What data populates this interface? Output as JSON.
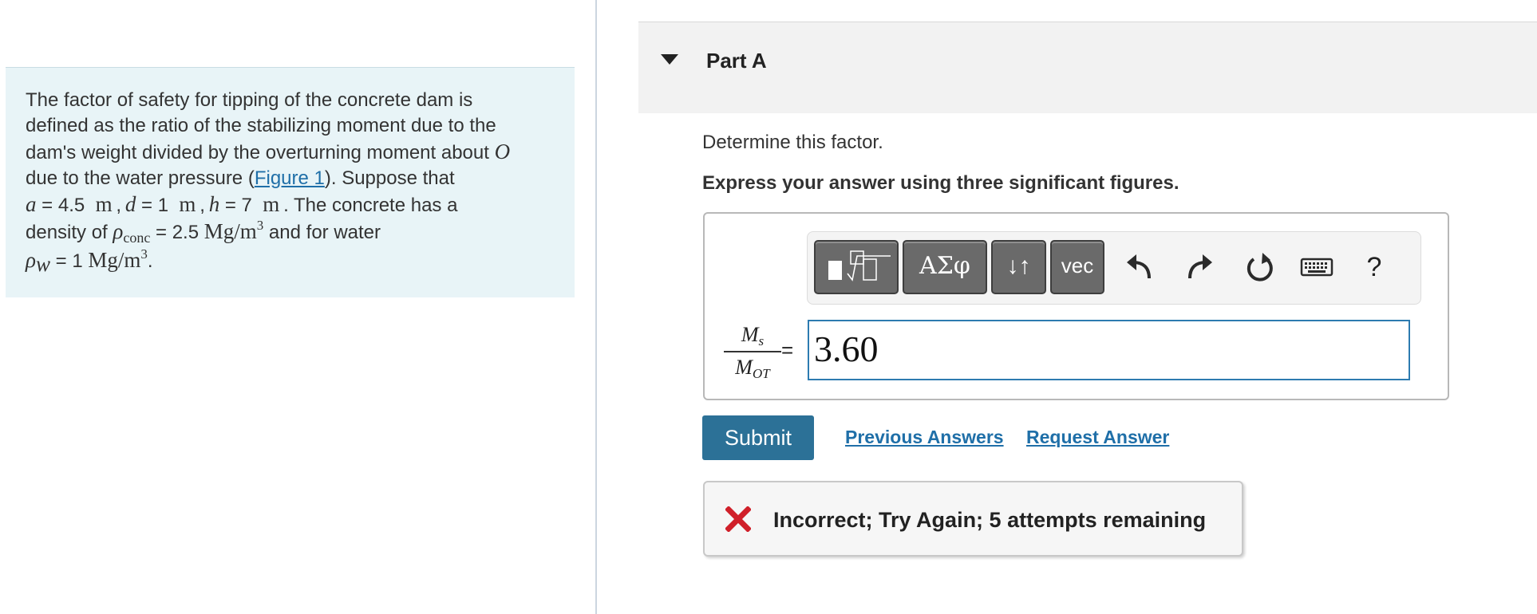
{
  "problem": {
    "line1": "The factor of safety for tipping of the concrete dam is",
    "line2": "defined as the ratio of the stabilizing moment due to the",
    "line3_pre": "dam's weight divided by the overturning moment about ",
    "point_O": "O",
    "line4_pre": "due to the water pressure (",
    "figure_link": "Figure 1",
    "line4_post": "). Suppose that",
    "var_a": "a",
    "eq_a": " = 4.5",
    "unit_m": "m",
    "var_d": "d",
    "eq_d": " = 1",
    "var_h": "h",
    "eq_h": " = 7",
    "line5_post": ". The concrete has a",
    "density_pre": "density of ",
    "rho": "ρ",
    "conc_sub": "conc",
    "eq_rho": " = 2.5",
    "density_unit": "Mg/m",
    "cube": "3",
    "density_post": " and for water",
    "w_sub": "w",
    "eq_rho_w": " = 1",
    "period": "."
  },
  "part": {
    "title": "Part A",
    "prompt": "Determine this factor.",
    "instruction": "Express your answer using three significant figures."
  },
  "toolbar": {
    "greek_label": "ΑΣφ",
    "arrows_label": "↓↑",
    "vec_label": "vec",
    "help_label": "?"
  },
  "answer": {
    "numerator_var": "M",
    "numerator_sub": "s",
    "denominator_var": "M",
    "denominator_sub": "OT",
    "equals": "=",
    "value": "3.60"
  },
  "actions": {
    "submit_label": "Submit",
    "previous_answers": "Previous Answers",
    "request_answer": "Request Answer"
  },
  "feedback": {
    "text": "Incorrect; Try Again; 5 attempts remaining",
    "status_color": "#d0202a"
  }
}
